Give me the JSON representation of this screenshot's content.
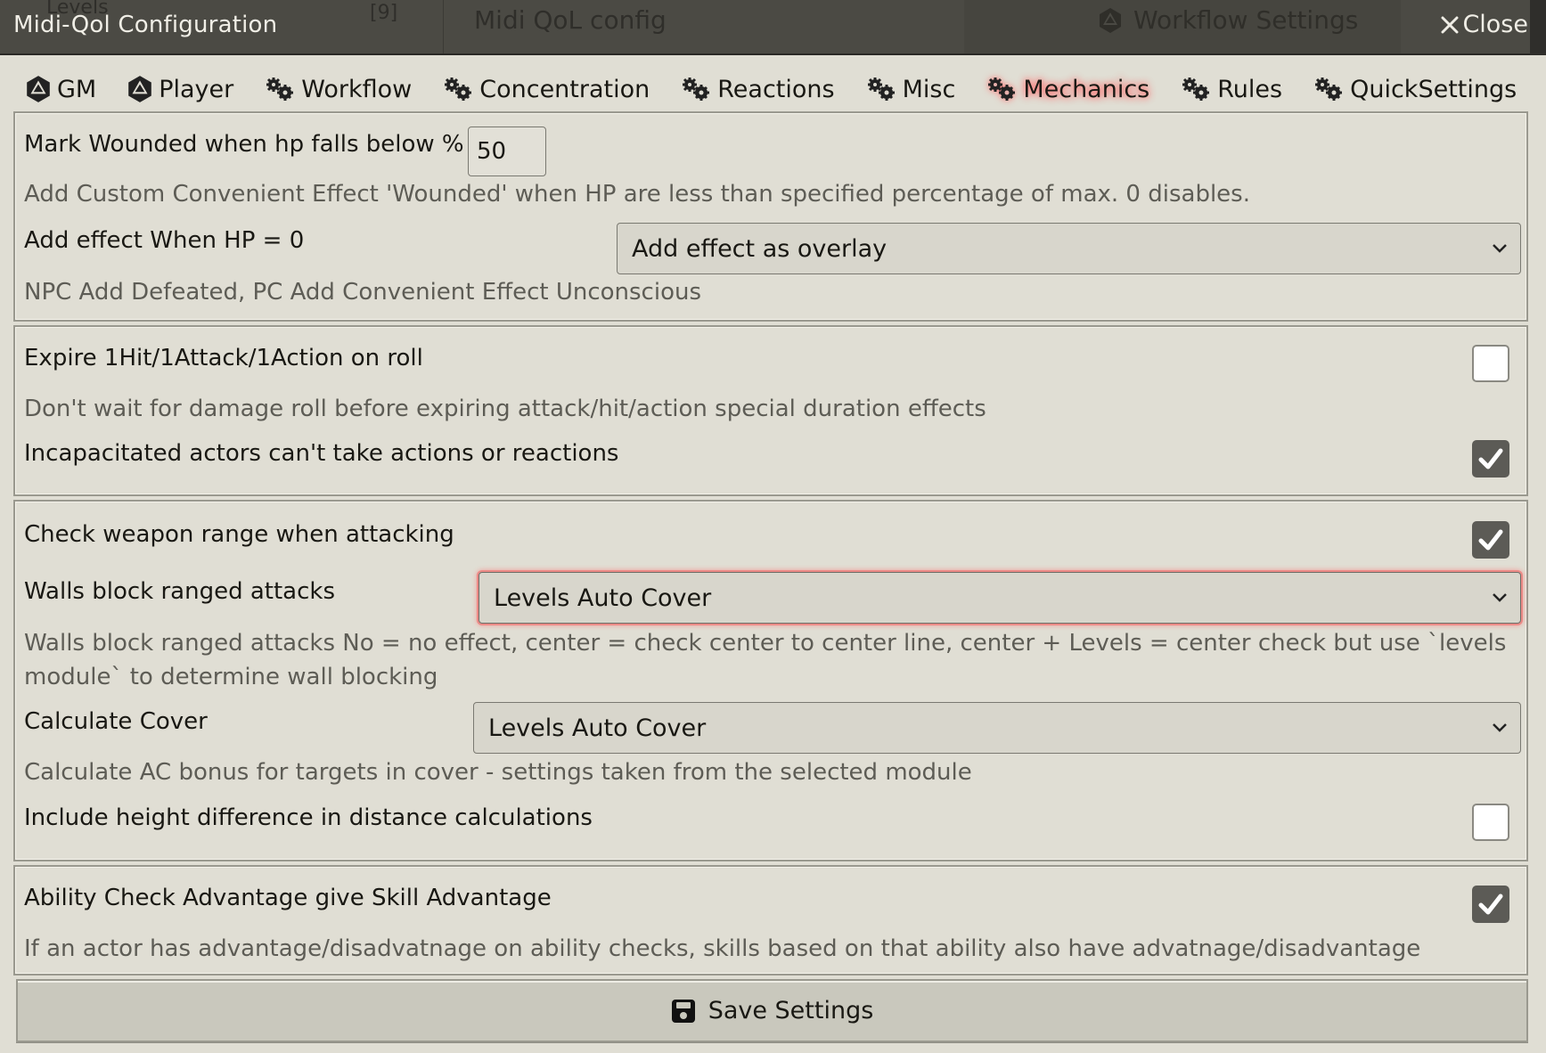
{
  "window": {
    "title": "Midi-Qol Configuration",
    "close_label": "Close",
    "background_text": {
      "levels": "Levels",
      "count": "[9]",
      "config": "Midi QoL config",
      "workflow": "Workflow Settings"
    }
  },
  "tabs": [
    {
      "label": "GM",
      "icon": "d20-icon",
      "active": false
    },
    {
      "label": "Player",
      "icon": "d20-icon",
      "active": false
    },
    {
      "label": "Workflow",
      "icon": "cogs-icon",
      "active": false
    },
    {
      "label": "Concentration",
      "icon": "cogs-icon",
      "active": false
    },
    {
      "label": "Reactions",
      "icon": "cogs-icon",
      "active": false
    },
    {
      "label": "Misc",
      "icon": "cogs-icon",
      "active": false
    },
    {
      "label": "Mechanics",
      "icon": "cogs-icon",
      "active": true
    },
    {
      "label": "Rules",
      "icon": "cogs-icon",
      "active": false
    },
    {
      "label": "QuickSettings",
      "icon": "cogs-icon",
      "active": false
    }
  ],
  "settings": {
    "mark_wounded": {
      "label": "Mark Wounded when hp falls below %",
      "value": "50",
      "hint": "Add Custom Convenient Effect 'Wounded' when HP are less than specified percentage of max. 0 disables."
    },
    "add_effect_hp0": {
      "label": "Add effect When HP = 0",
      "selected": "Add effect as overlay",
      "hint": "NPC Add Defeated, PC Add Convenient Effect Unconscious"
    },
    "expire_on_roll": {
      "label": "Expire 1Hit/1Attack/1Action on roll",
      "checked": false,
      "hint": "Don't wait for damage roll before expiring attack/hit/action special duration effects"
    },
    "incapacitated": {
      "label": "Incapacitated actors can't take actions or reactions",
      "checked": true
    },
    "check_range": {
      "label": "Check weapon range when attacking",
      "checked": true
    },
    "walls_block": {
      "label": "Walls block ranged attacks",
      "selected": "Levels Auto Cover",
      "hint_line1": "Walls block ranged attacks No = no effect, center = check center to center line, center + Levels = center check but use `levels",
      "hint_line2": "module` to determine wall blocking"
    },
    "calculate_cover": {
      "label": "Calculate Cover",
      "selected": "Levels Auto Cover",
      "hint": "Calculate AC bonus for targets in cover - settings taken from the selected module"
    },
    "height_difference": {
      "label": "Include height difference in distance calculations",
      "checked": false
    },
    "ability_skill_adv": {
      "label": "Ability Check Advantage give Skill Advantage",
      "checked": true,
      "hint": "If an actor has advantage/disadvatnage on ability checks, skills based on that ability also have advatnage/disadvantage"
    }
  },
  "footer": {
    "save_label": "Save Settings"
  },
  "colors": {
    "focus_glow": "#ec8a86",
    "checkbox_checked": "#5c5b56",
    "hint_text": "#5d5c55",
    "titlebar": "#4b4a44"
  }
}
